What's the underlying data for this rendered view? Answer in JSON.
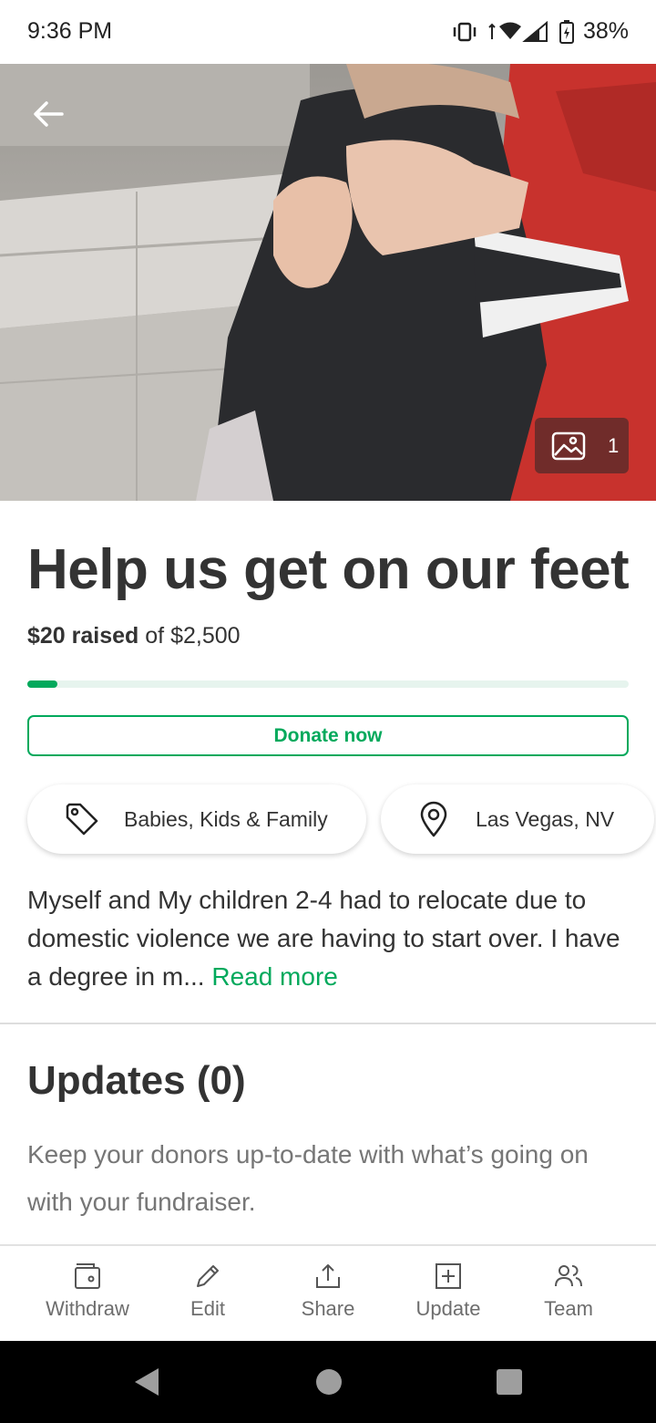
{
  "status_bar": {
    "time": "9:36 PM",
    "battery": "38%"
  },
  "hero": {
    "photo_count": "1"
  },
  "fundraiser": {
    "title": "Help us get on our feet",
    "raised_amount": "$20 raised",
    "goal_text": "of $2,500",
    "progress_fraction": 0.008,
    "donate_label": "Donate now",
    "category": "Babies, Kids & Family",
    "location": "Las Vegas, NV",
    "story_excerpt": "Myself and My children 2-4 had to relocate due to domestic violence  we are having to start over. I have a degree in m... ",
    "read_more": "Read more"
  },
  "updates": {
    "title": "Updates (0)",
    "description": "Keep your donors up-to-date with what’s going on with your fundraiser."
  },
  "actions": {
    "withdraw": "Withdraw",
    "edit": "Edit",
    "share": "Share",
    "update": "Update",
    "team": "Team"
  },
  "colors": {
    "accent": "#02a95c",
    "text": "#333333",
    "muted": "#767676"
  }
}
